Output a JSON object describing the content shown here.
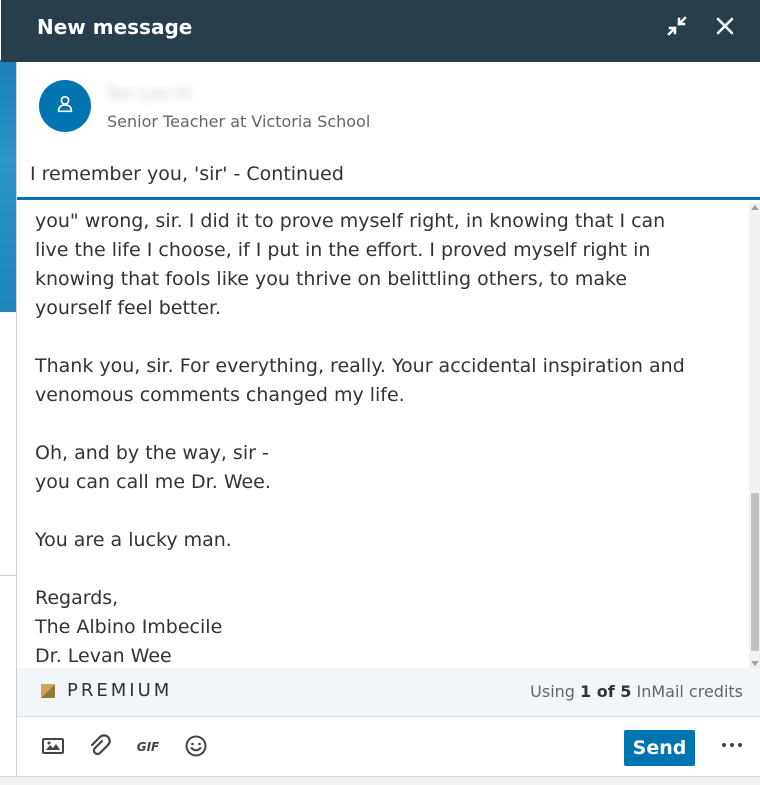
{
  "window": {
    "title": "New message"
  },
  "recipient": {
    "name": "Tan Lee Hi",
    "headline": "Senior Teacher at Victoria School"
  },
  "subject": {
    "value": "I remember you, 'sir' - Continued"
  },
  "message": {
    "body": "you\" wrong, sir. I did it to prove myself right, in knowing that I can\nlive the life I choose, if I put in the effort. I proved myself right in\nknowing that fools like you thrive on belittling others, to make\nyourself feel better.\n\nThank you, sir. For everything, really. Your accidental inspiration and\nvenomous comments changed my life.\n\nOh, and by the way, sir -\nyou can call me Dr. Wee.\n\nYou are a lucky man.\n\nRegards,\nThe Albino Imbecile\nDr. Levan Wee"
  },
  "premium": {
    "label": "PREMIUM",
    "credits_prefix": "Using ",
    "credits_count": "1 of 5",
    "credits_suffix": " InMail credits"
  },
  "toolbar": {
    "gif_label": "GIF",
    "send_label": "Send"
  },
  "colors": {
    "header_bg": "#283e4a",
    "accent": "#0073b1",
    "premium_gold": "#c9a753"
  },
  "icons": [
    "minimize-icon",
    "close-icon",
    "person-icon",
    "image-icon",
    "attachment-icon",
    "gif-icon",
    "emoji-icon",
    "more-icon"
  ]
}
